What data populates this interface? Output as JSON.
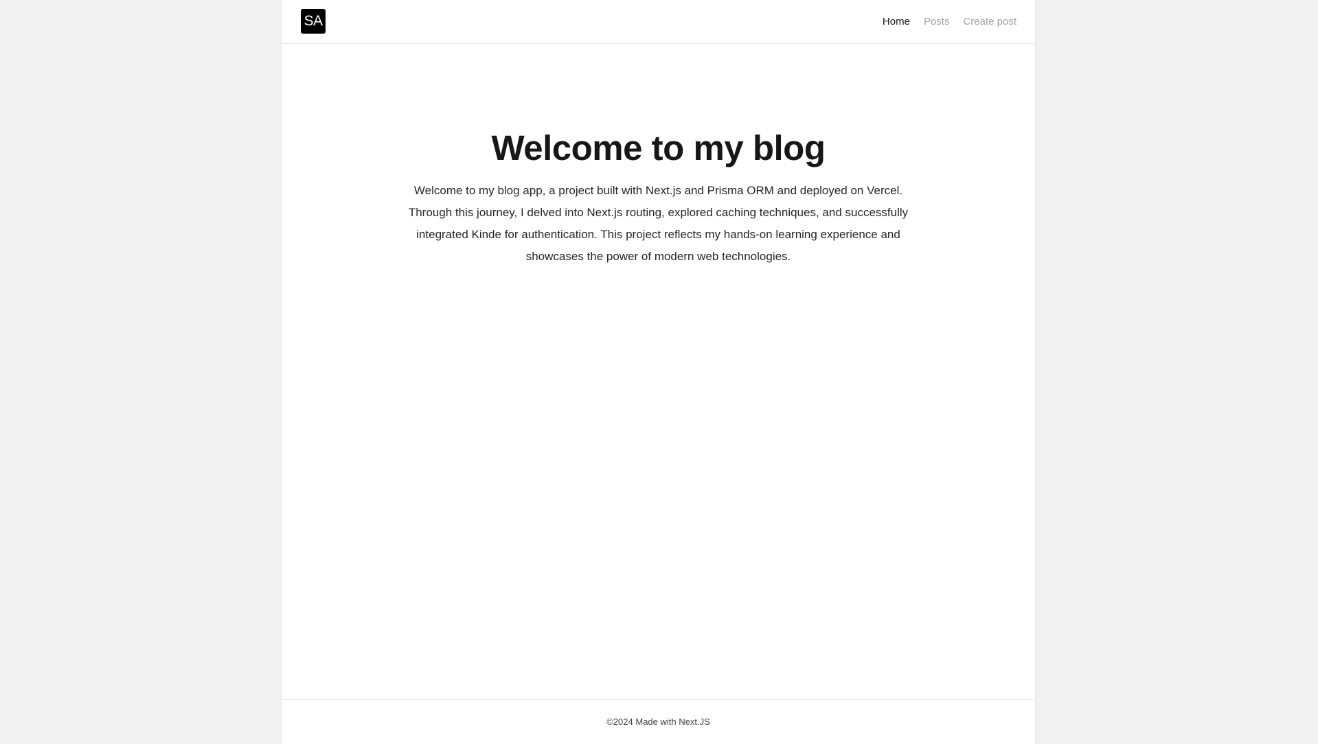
{
  "header": {
    "logo_text": "SA",
    "nav": [
      {
        "label": "Home",
        "active": true
      },
      {
        "label": "Posts",
        "active": false
      },
      {
        "label": "Create post",
        "active": false
      }
    ]
  },
  "hero": {
    "title": "Welcome to my blog",
    "description": "Welcome to my blog app, a project built with Next.js and Prisma ORM and deployed on Vercel. Through this journey, I delved into Next.js routing, explored caching techniques, and successfully integrated Kinde for authentication. This project reflects my hands-on learning experience and showcases the power of modern web technologies."
  },
  "footer": {
    "text": "©2024 Made with Next.JS"
  },
  "colors": {
    "page_background": "#f1f1f1",
    "content_background": "#ffffff",
    "logo_background": "#000000",
    "nav_active": "#171717",
    "nav_inactive": "#a3a3a3"
  }
}
